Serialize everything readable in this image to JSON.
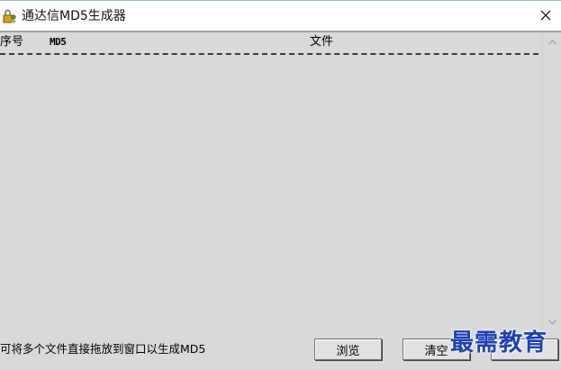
{
  "window": {
    "title": "通达信MD5生成器",
    "app_icon": "lock-key-icon",
    "close_icon": "close-icon"
  },
  "list": {
    "columns": [
      "序号",
      "MD5",
      "文件"
    ],
    "rows": []
  },
  "footer": {
    "hint": "可将多个文件直接拖放到窗口以生成MD5",
    "buttons": {
      "browse": "浏览",
      "clear": "清空",
      "exit": ""
    }
  },
  "watermark": "最需教育"
}
